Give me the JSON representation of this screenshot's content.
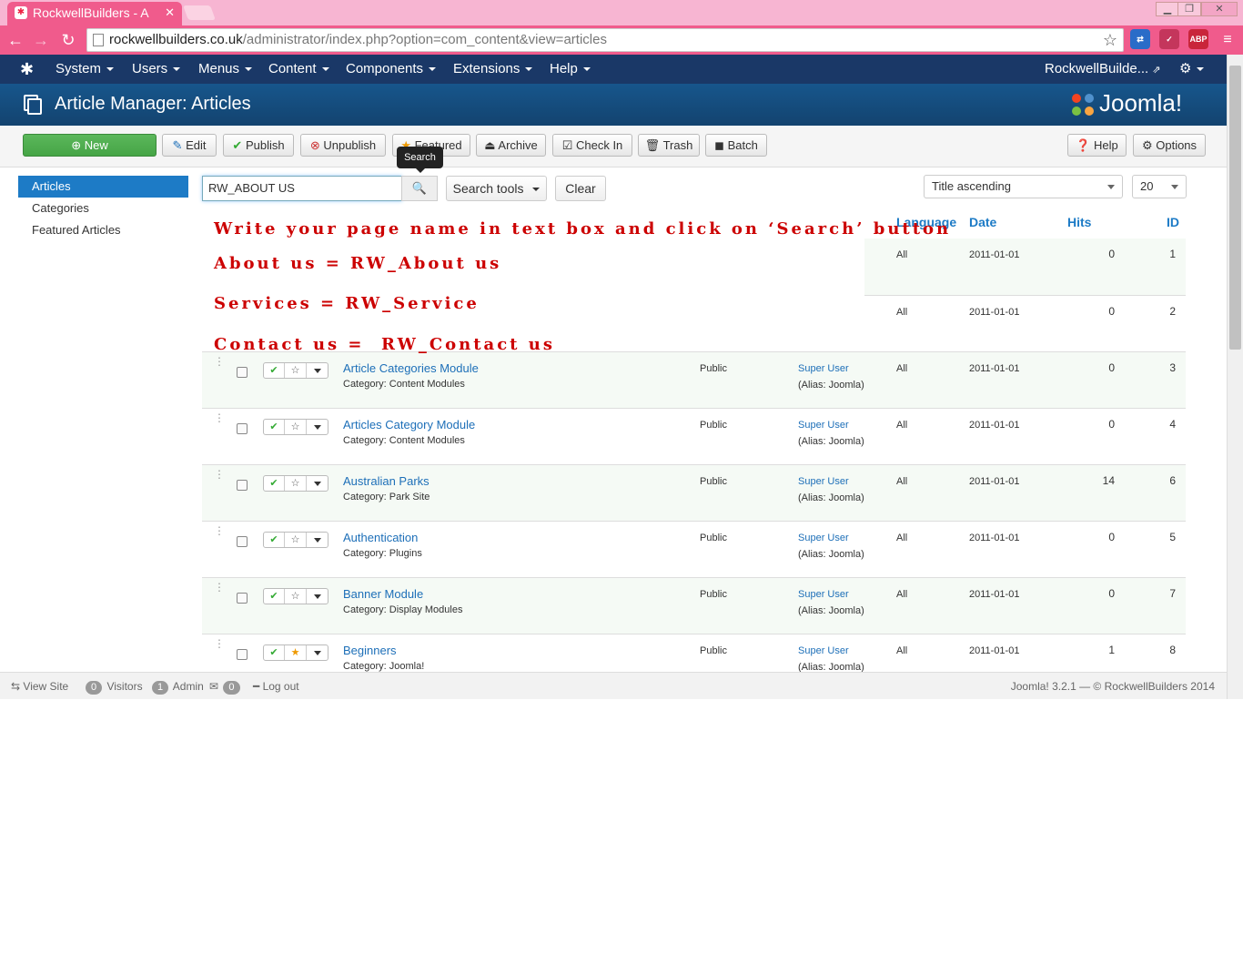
{
  "browser": {
    "tab_title": "RockwellBuilders - A",
    "url_domain": "rockwellbuilders.co.uk",
    "url_path": "/administrator/index.php?option=com_content&view=articles",
    "ext_abp": "ABP"
  },
  "topnav": {
    "menus": [
      "System",
      "Users",
      "Menus",
      "Content",
      "Components",
      "Extensions",
      "Help"
    ],
    "site_name": "RockwellBuilde..."
  },
  "header": {
    "title": "Article Manager: Articles",
    "brand": "Joomla!"
  },
  "toolbar": {
    "new": "New",
    "edit": "Edit",
    "publish": "Publish",
    "unpublish": "Unpublish",
    "featured": "Featured",
    "archive": "Archive",
    "checkin": "Check In",
    "trash": "Trash",
    "batch": "Batch",
    "help": "Help",
    "options": "Options"
  },
  "tooltip": "Search",
  "sidebar": {
    "items": [
      "Articles",
      "Categories",
      "Featured Articles"
    ]
  },
  "filters": {
    "search_value": "RW_ABOUT US",
    "search_tools": "Search tools",
    "clear": "Clear",
    "sort": "Title ascending",
    "limit": "20"
  },
  "columns": {
    "language": "Language",
    "date": "Date",
    "hits": "Hits",
    "id": "ID"
  },
  "overlay": {
    "line1": "Write your page name in text box and click on ‘Search’ button",
    "line2": "About us = RW_About us",
    "line3": "Services = RW_Service",
    "line4": "Contact us =  RW_Contact us"
  },
  "top_rows": [
    {
      "language": "All",
      "date": "2011-01-01",
      "hits": "0",
      "id": "1"
    },
    {
      "language": "All",
      "date": "2011-01-01",
      "hits": "0",
      "id": "2"
    }
  ],
  "rows": [
    {
      "title": "Article Categories Module",
      "category": "Category: Content Modules",
      "access": "Public",
      "author": "Super User",
      "alias": "(Alias: Joomla)",
      "language": "All",
      "date": "2011-01-01",
      "hits": "0",
      "id": "3",
      "featured": false
    },
    {
      "title": "Articles Category Module",
      "category": "Category: Content Modules",
      "access": "Public",
      "author": "Super User",
      "alias": "(Alias: Joomla)",
      "language": "All",
      "date": "2011-01-01",
      "hits": "0",
      "id": "4",
      "featured": false
    },
    {
      "title": "Australian Parks",
      "category": "Category: Park Site",
      "access": "Public",
      "author": "Super User",
      "alias": "(Alias: Joomla)",
      "language": "All",
      "date": "2011-01-01",
      "hits": "14",
      "id": "6",
      "featured": false
    },
    {
      "title": "Authentication",
      "category": "Category: Plugins",
      "access": "Public",
      "author": "Super User",
      "alias": "(Alias: Joomla)",
      "language": "All",
      "date": "2011-01-01",
      "hits": "0",
      "id": "5",
      "featured": false
    },
    {
      "title": "Banner Module",
      "category": "Category: Display Modules",
      "access": "Public",
      "author": "Super User",
      "alias": "(Alias: Joomla)",
      "language": "All",
      "date": "2011-01-01",
      "hits": "0",
      "id": "7",
      "featured": false
    },
    {
      "title": "Beginners",
      "category": "Category: Joomla!",
      "access": "Public",
      "author": "Super User",
      "alias": "(Alias: Joomla)",
      "language": "All",
      "date": "2011-01-01",
      "hits": "1",
      "id": "8",
      "featured": true
    }
  ],
  "status": {
    "view_site": "View Site",
    "visitors_count": "0",
    "visitors": "Visitors",
    "admin_count": "1",
    "admin": "Admin",
    "msg_count": "0",
    "logout": "Log out",
    "copyright": "Joomla! 3.2.1 — © RockwellBuilders 2014"
  }
}
